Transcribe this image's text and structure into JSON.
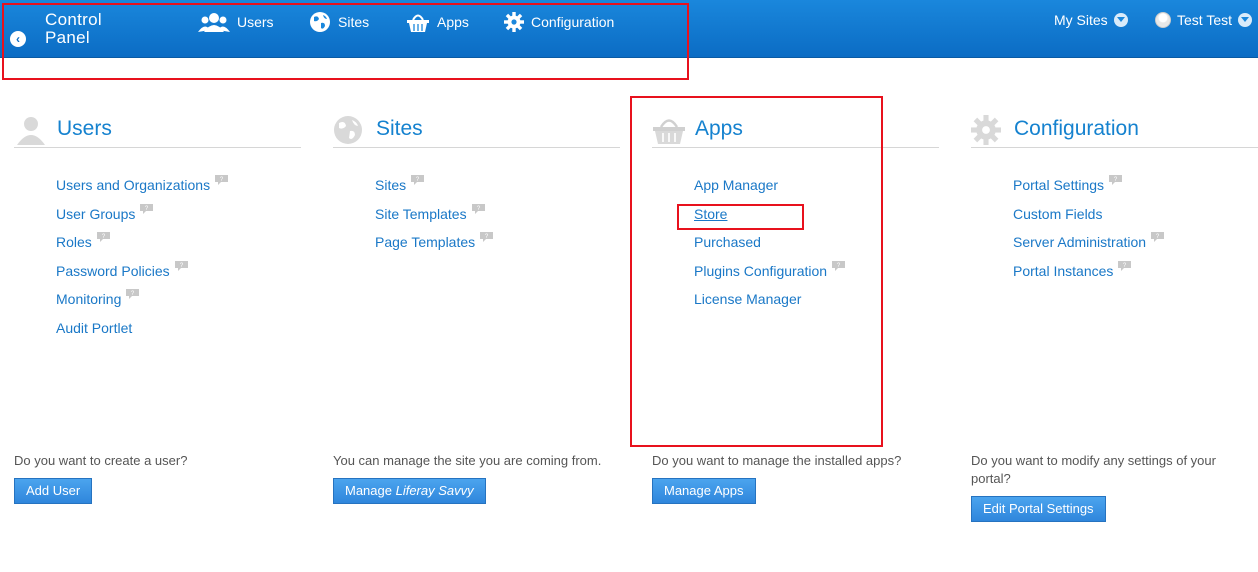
{
  "header": {
    "brand_line1": "Control",
    "brand_line2": "Panel",
    "nav": [
      {
        "label": "Users",
        "icon": "users-icon"
      },
      {
        "label": "Sites",
        "icon": "globe-icon"
      },
      {
        "label": "Apps",
        "icon": "basket-icon"
      },
      {
        "label": "Configuration",
        "icon": "gear-icon"
      }
    ],
    "my_sites": "My Sites",
    "user_name": "Test Test"
  },
  "columns": [
    {
      "title": "Users",
      "icon": "users-icon",
      "links": [
        "Users and Organizations",
        "User Groups",
        "Roles",
        "Password Policies",
        "Monitoring",
        "Audit Portlet"
      ],
      "question": "Do you want to create a user?",
      "button": "Add User"
    },
    {
      "title": "Sites",
      "icon": "globe-icon",
      "links": [
        "Sites",
        "Site Templates",
        "Page Templates"
      ],
      "question": "You can manage the site you are coming from.",
      "button_prefix": "Manage ",
      "button_site": "Liferay Savvy"
    },
    {
      "title": "Apps",
      "icon": "basket-icon",
      "links": [
        "App Manager",
        "Store",
        "Purchased",
        "Plugins Configuration",
        "License Manager"
      ],
      "question": "Do you want to manage the installed apps?",
      "button": "Manage Apps"
    },
    {
      "title": "Configuration",
      "icon": "gear-icon",
      "links": [
        "Portal Settings",
        "Custom Fields",
        "Server Administration",
        "Portal Instances"
      ],
      "question_line1": "Do you want to modify any settings of your",
      "question_line2": "portal?",
      "button": "Edit Portal Settings"
    }
  ],
  "colors": {
    "topbar": "#0b6cc4",
    "link": "#1a78c7",
    "title": "#1582cf",
    "annotation": "#e8111d"
  }
}
